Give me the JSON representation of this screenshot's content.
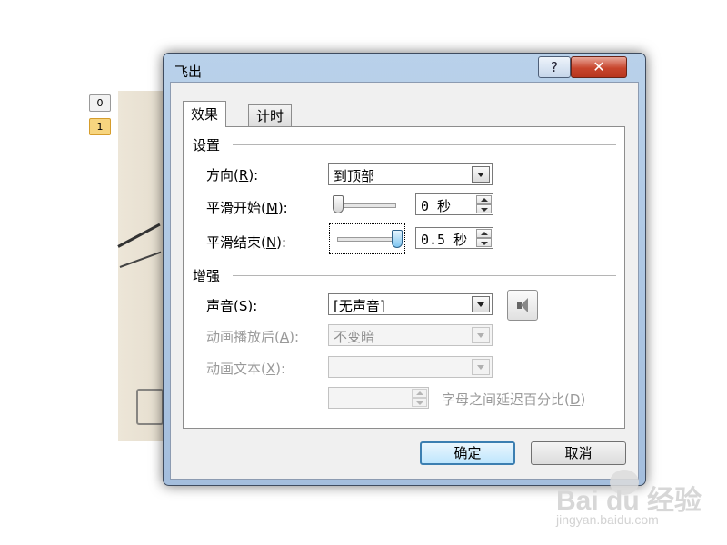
{
  "slides": {
    "numbers": [
      "0",
      "1"
    ]
  },
  "dialog": {
    "title": "飞出",
    "help_glyph": "?",
    "close_glyph": "✕"
  },
  "tabs": [
    {
      "label": "效果",
      "active": true
    },
    {
      "label": "计时",
      "active": false
    }
  ],
  "settings": {
    "group_label": "设置",
    "direction": {
      "label": "方向",
      "key": "R",
      "value": "到顶部"
    },
    "smooth_start": {
      "label": "平滑开始",
      "key": "M",
      "value": "0 秒",
      "slider_fraction": 0
    },
    "smooth_end": {
      "label": "平滑结束",
      "key": "N",
      "value": "0.5 秒",
      "slider_fraction": 1
    }
  },
  "enhance": {
    "group_label": "增强",
    "sound": {
      "label": "声音",
      "key": "S",
      "value": "[无声音]"
    },
    "after_animation": {
      "label": "动画播放后",
      "key": "A",
      "value": "不变暗"
    },
    "animate_text": {
      "label": "动画文本",
      "key": "X",
      "value": ""
    },
    "delay_between_letters": {
      "label": "字母之间延迟百分比",
      "key": "D",
      "value": ""
    }
  },
  "buttons": {
    "ok": "确定",
    "cancel": "取消"
  },
  "watermark": {
    "brand": "Bai du 经验",
    "url": "jingyan.baidu.com"
  }
}
